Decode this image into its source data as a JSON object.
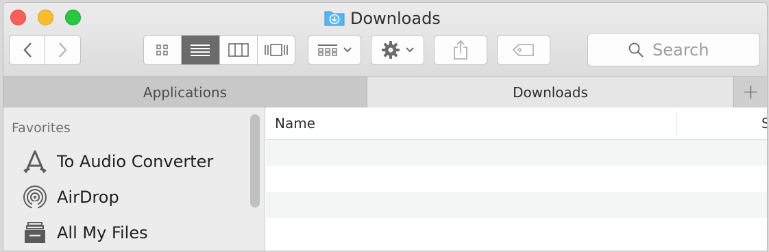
{
  "window": {
    "title": "Downloads",
    "folder_icon": "downloads-folder-icon"
  },
  "toolbar": {
    "back_icon": "chevron-left-icon",
    "forward_icon": "chevron-right-icon",
    "views": [
      "icon-view-icon",
      "list-view-icon",
      "column-view-icon",
      "cover-flow-icon"
    ],
    "active_view": "list",
    "arrange_icon": "arrange-grid-icon",
    "action_icon": "gear-icon",
    "share_icon": "share-icon",
    "tag_icon": "tag-icon",
    "search": {
      "placeholder": "Search",
      "value": ""
    }
  },
  "tabs": [
    {
      "label": "Applications",
      "active": false
    },
    {
      "label": "Downloads",
      "active": true
    }
  ],
  "tab_add_label": "+",
  "sidebar": {
    "section": "Favorites",
    "items": [
      {
        "label": "To Audio Converter",
        "icon": "app-store-icon"
      },
      {
        "label": "AirDrop",
        "icon": "airdrop-icon"
      },
      {
        "label": "All My Files",
        "icon": "all-files-icon"
      }
    ]
  },
  "list": {
    "columns": [
      "Name",
      "S"
    ]
  },
  "colors": {
    "close": "#fd5e57",
    "minimize": "#febc2e",
    "zoom": "#28c840",
    "folder": "#3aa7f2"
  }
}
